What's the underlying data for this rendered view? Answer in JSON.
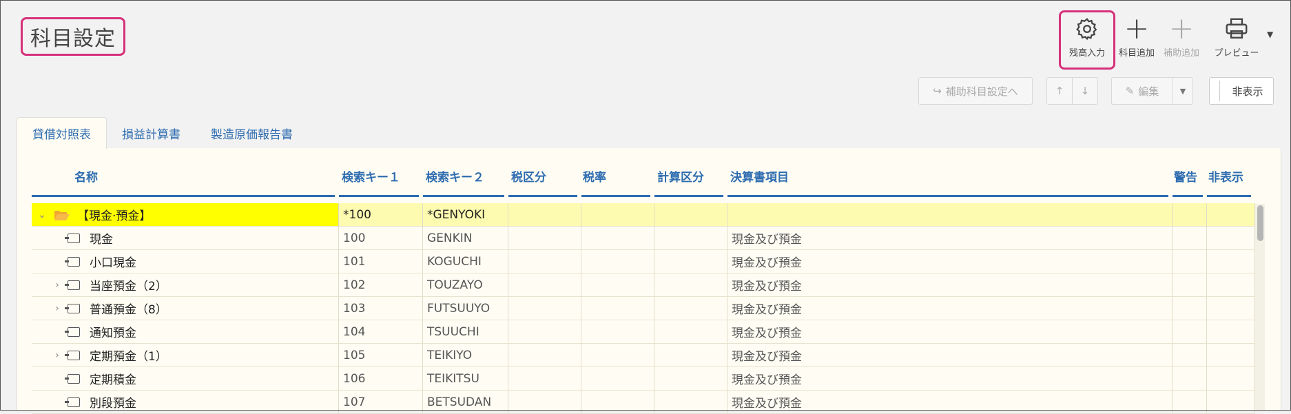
{
  "page_title": "科目設定",
  "toolbar": {
    "balance_input": "残高入力",
    "add_account": "科目追加",
    "add_sub": "補助追加",
    "preview": "プレビュー"
  },
  "actions": {
    "sub_settings": "補助科目設定へ",
    "up": "↑",
    "down": "↓",
    "edit": "編集",
    "hide": "非表示"
  },
  "tabs": [
    {
      "label": "貸借対照表",
      "active": true
    },
    {
      "label": "損益計算書",
      "active": false
    },
    {
      "label": "製造原価報告書",
      "active": false
    }
  ],
  "columns": {
    "name": "名称",
    "key1": "検索キー１",
    "key2": "検索キー２",
    "tax_cat": "税区分",
    "tax_rate": "税率",
    "calc_cat": "計算区分",
    "statement_item": "決算書項目",
    "warning": "警告",
    "hidden": "非表示"
  },
  "rows": [
    {
      "name": "【現金·預金】",
      "key1": "*100",
      "key2": "*GENYOKI",
      "item": "",
      "expand": "⌄",
      "group": true
    },
    {
      "name": "現金",
      "key1": "100",
      "key2": "GENKIN",
      "item": "現金及び預金",
      "expand": ""
    },
    {
      "name": "小口現金",
      "key1": "101",
      "key2": "KOGUCHI",
      "item": "現金及び預金",
      "expand": ""
    },
    {
      "name": "当座預金（2）",
      "key1": "102",
      "key2": "TOUZAYO",
      "item": "現金及び預金",
      "expand": "›"
    },
    {
      "name": "普通預金（8）",
      "key1": "103",
      "key2": "FUTSUUYO",
      "item": "現金及び預金",
      "expand": "›"
    },
    {
      "name": "通知預金",
      "key1": "104",
      "key2": "TSUUCHI",
      "item": "現金及び預金",
      "expand": ""
    },
    {
      "name": "定期預金（1）",
      "key1": "105",
      "key2": "TEIKIYO",
      "item": "現金及び預金",
      "expand": "›"
    },
    {
      "name": "定期積金",
      "key1": "106",
      "key2": "TEIKITSU",
      "item": "現金及び預金",
      "expand": ""
    },
    {
      "name": "別段預金",
      "key1": "107",
      "key2": "BETSUDAN",
      "item": "現金及び預金",
      "expand": ""
    }
  ]
}
